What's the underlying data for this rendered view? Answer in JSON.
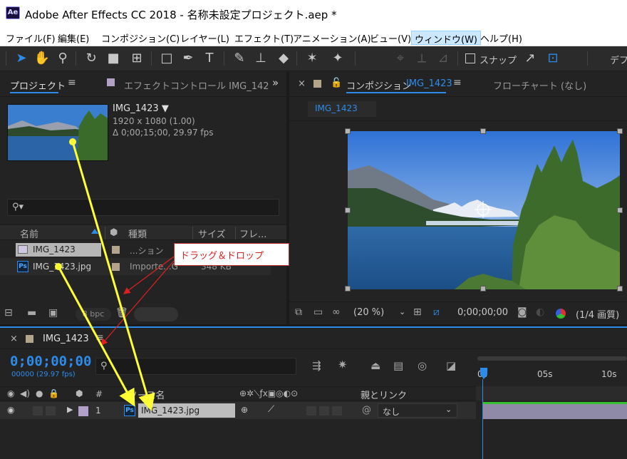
{
  "window": {
    "title": "Adobe After Effects CC 2018 - 名称未設定プロジェクト.aep *",
    "app_icon": "Ae"
  },
  "menu": [
    "ファイル(F)",
    "編集(E)",
    "コンポジション(C)",
    "レイヤー(L)",
    "エフェクト(T)",
    "アニメーション(A)",
    "ビュー(V)",
    "ウィンドウ(W)",
    "ヘルプ(H)"
  ],
  "toolbar": {
    "snap_label": "スナップ",
    "default_label": "デフ"
  },
  "project": {
    "tab_label": "プロジェクト",
    "effect_tab_label": "エフェクトコントロール IMG_142",
    "item_name": "IMG_1423 ▼",
    "item_resolution": "1920 x 1080 (1.00)",
    "item_duration": "Δ 0;00;15;00, 29.97 fps",
    "columns": {
      "name": "名前",
      "type": "種類",
      "size": "サイズ",
      "frame": "フレ..."
    },
    "rows": [
      {
        "name": "IMG_1423",
        "type": "...ション",
        "size": "",
        "color": "#b3a58c",
        "icon": "composition-icon"
      },
      {
        "name": "IMG_1423.jpg",
        "type": "Importe...G",
        "size": "348 KB",
        "color": "#b3a58c",
        "icon": "photoshop-file-icon"
      }
    ],
    "bpc_label": "8 bpc"
  },
  "viewer": {
    "comp_tab_label": "コンポジション",
    "comp_tab_name": "IMG_1423",
    "flowchart_label": "フローチャート (なし)",
    "subtab_label": "IMG_1423",
    "zoom": "(20 %)",
    "timecode": "0;00;00;00",
    "resolution": "(1/4 画質)"
  },
  "annotation": {
    "label": "ドラッグ＆ドロップ",
    "color": "#e02020"
  },
  "timeline": {
    "tab_label": "IMG_1423",
    "timecode": "0;00;00;00",
    "frame_info": "00000 (29.97 fps)",
    "source_name_header": "ソース名",
    "parent_header": "親とリンク",
    "layer": {
      "number": "1",
      "name": "IMG_1423.jpg",
      "parent": "なし"
    },
    "ruler": [
      "0s",
      "05s",
      "10s"
    ]
  },
  "colors": {
    "accent": "#2d8ceb",
    "arrow": "#ffff33"
  }
}
